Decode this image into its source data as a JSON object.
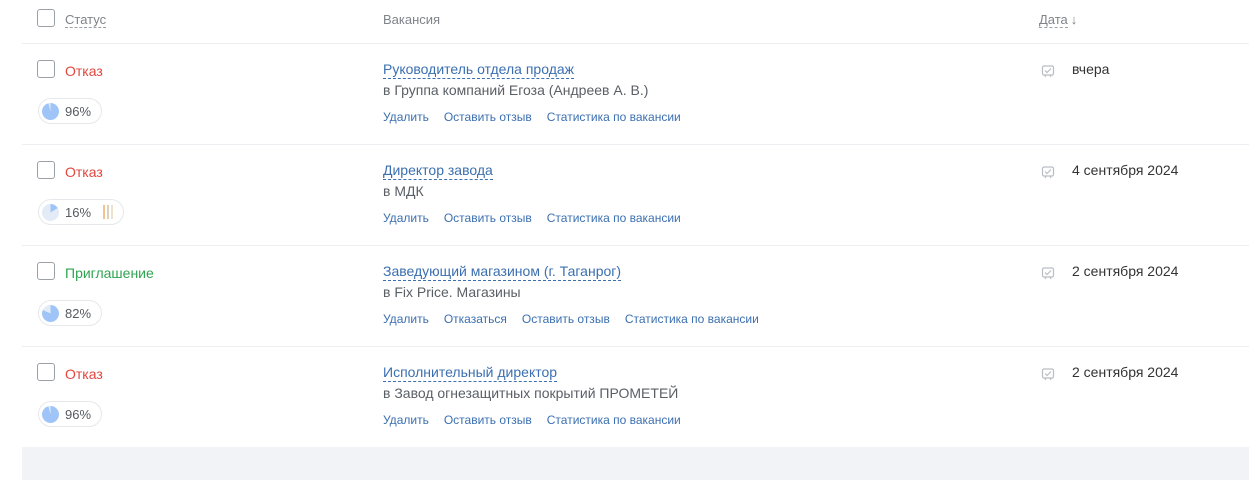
{
  "header": {
    "status": "Статус",
    "vacancy": "Вакансия",
    "date": "Дата",
    "sort_arrow": "↓"
  },
  "colors": {
    "rejected": "#e2463d",
    "invited": "#2ea44f",
    "link": "#3b6fb0",
    "pie_fill": "#9fc5f8"
  },
  "rows": [
    {
      "status": "Отказ",
      "status_type": "rejected",
      "match": "96%",
      "match_value": 0.96,
      "title": "Руководитель отдела продаж",
      "company": "в Группа компаний Егоза (Андреев А. В.)",
      "actions": [
        "Удалить",
        "Оставить отзыв",
        "Статистика по вакансии"
      ],
      "date": "вчера"
    },
    {
      "status": "Отказ",
      "status_type": "rejected",
      "match": "16%",
      "match_value": 0.16,
      "title": "Директор завода",
      "company": "в МДК",
      "actions": [
        "Удалить",
        "Оставить отзыв",
        "Статистика по вакансии"
      ],
      "date": "4 сентября 2024"
    },
    {
      "status": "Приглашение",
      "status_type": "invited",
      "match": "82%",
      "match_value": 0.82,
      "title": "Заведующий магазином (г. Таганрог)",
      "company": "в Fix Price. Магазины",
      "actions": [
        "Удалить",
        "Отказаться",
        "Оставить отзыв",
        "Статистика по вакансии"
      ],
      "date": "2 сентября 2024"
    },
    {
      "status": "Отказ",
      "status_type": "rejected",
      "match": "96%",
      "match_value": 0.96,
      "title": "Исполнительный директор",
      "company": "в Завод огнезащитных покрытий ПРОМЕТЕЙ",
      "actions": [
        "Удалить",
        "Оставить отзыв",
        "Статистика по вакансии"
      ],
      "date": "2 сентября 2024"
    }
  ]
}
